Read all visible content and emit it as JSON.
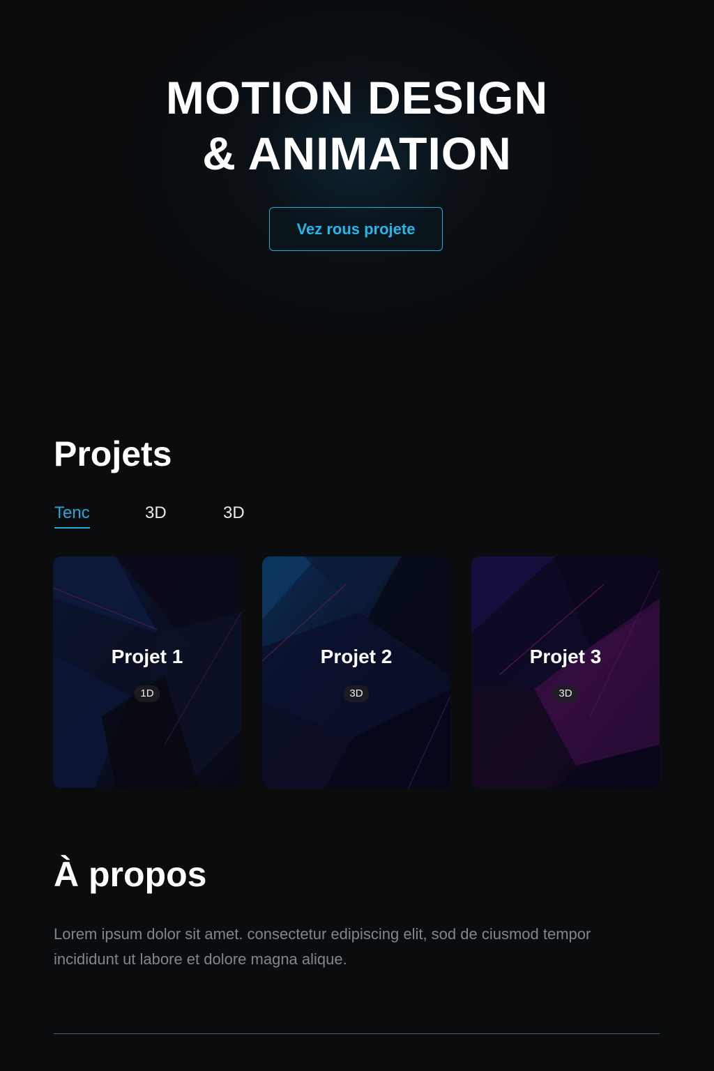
{
  "hero": {
    "title_line1": "MOTION DESIGN",
    "title_line2": "& ANIMATION",
    "cta_label": "Vez rous projete"
  },
  "projects": {
    "heading": "Projets",
    "tabs": [
      {
        "label": "Tenc",
        "active": true
      },
      {
        "label": "3D",
        "active": false
      },
      {
        "label": "3D",
        "active": false
      }
    ],
    "cards": [
      {
        "title": "Projet 1",
        "badge": "1D"
      },
      {
        "title": "Projet 2",
        "badge": "3D"
      },
      {
        "title": "Projet 3",
        "badge": "3D"
      }
    ]
  },
  "about": {
    "heading": "À propos",
    "text": "Lorem ipsum dolor sit amet. consectetur edipiscing elit, sod de ciusmod tempor incididunt ut labore et dolore magna alique."
  },
  "colors": {
    "background": "#0a0c0e",
    "accent": "#1fa9dc",
    "body_text": "#7d8790",
    "divider": "#3f6a7c"
  }
}
